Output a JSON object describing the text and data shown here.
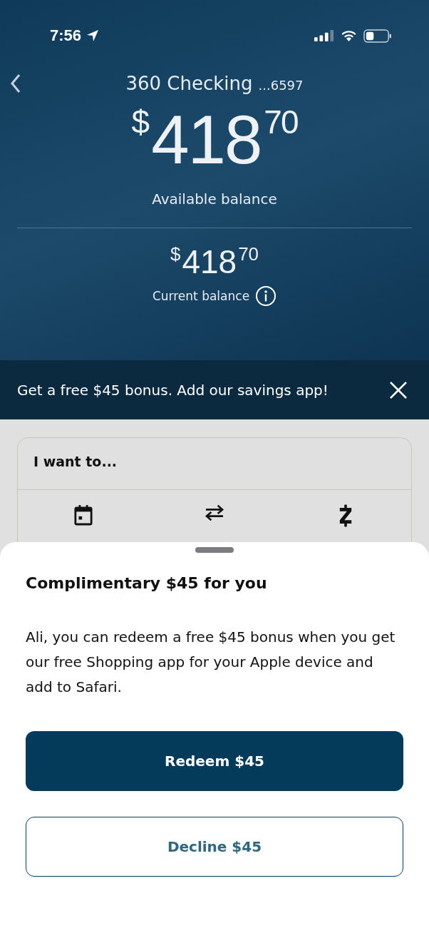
{
  "status_bar": {
    "time": "7:56"
  },
  "account": {
    "name": "360 Checking",
    "mask": "...6597"
  },
  "available": {
    "dollars": "$",
    "whole": "418",
    "cents": "70",
    "label": "Available balance"
  },
  "current": {
    "dollars": "$",
    "whole": "418",
    "cents": "70",
    "label": "Current balance"
  },
  "promo_banner": {
    "text": "Get a free $45 bonus. Add our savings app!"
  },
  "actions_card": {
    "title": "I want to...",
    "actions": [
      {
        "kind": "calendar"
      },
      {
        "kind": "transfer"
      },
      {
        "kind": "zelle"
      }
    ]
  },
  "sheet": {
    "title": "Complimentary $45 for you",
    "body": "Ali, you can redeem a free $45 bonus when you get our free Shopping app for your Apple device and add to Safari.",
    "primary": "Redeem $45",
    "secondary": "Decline $45"
  }
}
